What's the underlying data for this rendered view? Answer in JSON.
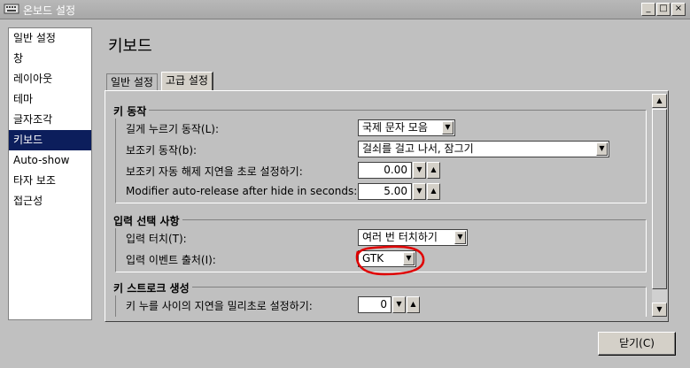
{
  "window": {
    "title": "온보드 설정",
    "controls": [
      "_",
      "□",
      "×"
    ]
  },
  "sidebar": {
    "items": [
      {
        "label": "일반 설정"
      },
      {
        "label": "창"
      },
      {
        "label": "레이아웃"
      },
      {
        "label": "테마"
      },
      {
        "label": "글자조각"
      },
      {
        "label": "키보드",
        "selected": true
      },
      {
        "label": "Auto-show"
      },
      {
        "label": "타자 보조"
      },
      {
        "label": "접근성"
      }
    ]
  },
  "main": {
    "heading": "키보드",
    "tabs": [
      {
        "label": "일반 설정",
        "active": false
      },
      {
        "label": "고급 설정",
        "active": true
      }
    ]
  },
  "sections": {
    "key_action": {
      "title": "키 동작",
      "long_press_label": "길게 누르기 동작(L):",
      "long_press_value": "국제 문자 모음",
      "modifier_label": "보조키 동작(b):",
      "modifier_value": "걸쇠를 걸고 나서, 잠그기",
      "auto_release_label": "보조키 자동 해제 지연을 초로 설정하기:",
      "auto_release_value": "0.00",
      "hide_release_label": "Modifier auto-release after hide in seconds:",
      "hide_release_value": "5.00"
    },
    "input": {
      "title": "입력 선택 사항",
      "touch_label": "입력 터치(T):",
      "touch_value": "여러 번 터치하기",
      "event_source_label": "입력 이벤트 출처(I):",
      "event_source_value": "GTK"
    },
    "keystroke": {
      "title": "키 스트로크 생성",
      "delay_label": "키 누를 사이의 지연을 밀리초로 설정하기:",
      "delay_value": "0"
    }
  },
  "footer": {
    "close_label": "닫기(C)"
  },
  "annotation_color": "#e00000"
}
